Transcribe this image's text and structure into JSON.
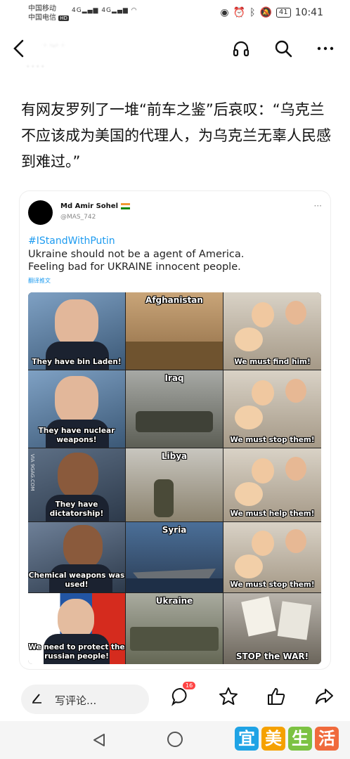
{
  "status_bar": {
    "carrier_1": "中国移动",
    "carrier_2": "中国电信",
    "carrier_2_badge": "HD",
    "signal_1": "4G",
    "signal_2": "4G",
    "battery": "41",
    "time": "10:41"
  },
  "header": {
    "back_icon": "back-arrow-icon",
    "username_blurred": "· ·-· ·",
    "subline_blurred": "· · · ·",
    "actions": [
      "headphone-icon",
      "search-icon",
      "more-icon"
    ]
  },
  "post": {
    "text": "有网友罗列了一堆“前车之鉴”后哀叹：“乌克兰不应该成为美国的代理人，为乌克兰无辜人民感到难过。”"
  },
  "tweet": {
    "name": "Md Amir Sohel",
    "handle": "@MAS_742",
    "more": "···",
    "hashtag": "#IStandWithPutin",
    "line1": "Ukraine should not be a agent of America.",
    "line2": "Feeling bad for UKRAINE innocent people.",
    "translate": "翻译推文"
  },
  "meme": {
    "watermark": "VIA 9GAG.COM",
    "rows": [
      {
        "left": "They have bin Laden!",
        "title": "Afghanistan",
        "right": "We must find him!"
      },
      {
        "left": "They have nuclear weapons!",
        "title": "Iraq",
        "right": "We must stop them!"
      },
      {
        "left": "They have dictatorship!",
        "title": "Libya",
        "right": "We must help them!"
      },
      {
        "left": "Chemical weapons was used!",
        "title": "Syria",
        "right": "We must stop them!"
      },
      {
        "left": "We need to protect the russian people!",
        "title": "Ukraine",
        "right": "STOP the WAR!"
      }
    ]
  },
  "bottom_bar": {
    "comment_placeholder": "写评论...",
    "comment_count": "16",
    "icons": [
      "comment-icon",
      "star-icon",
      "like-icon",
      "share-icon"
    ]
  },
  "nav": {
    "logo_chars": [
      "宜",
      "美",
      "生",
      "活"
    ],
    "logo_colors": [
      "#1fa3e5",
      "#f5a100",
      "#7cc242",
      "#f06a3c"
    ]
  }
}
